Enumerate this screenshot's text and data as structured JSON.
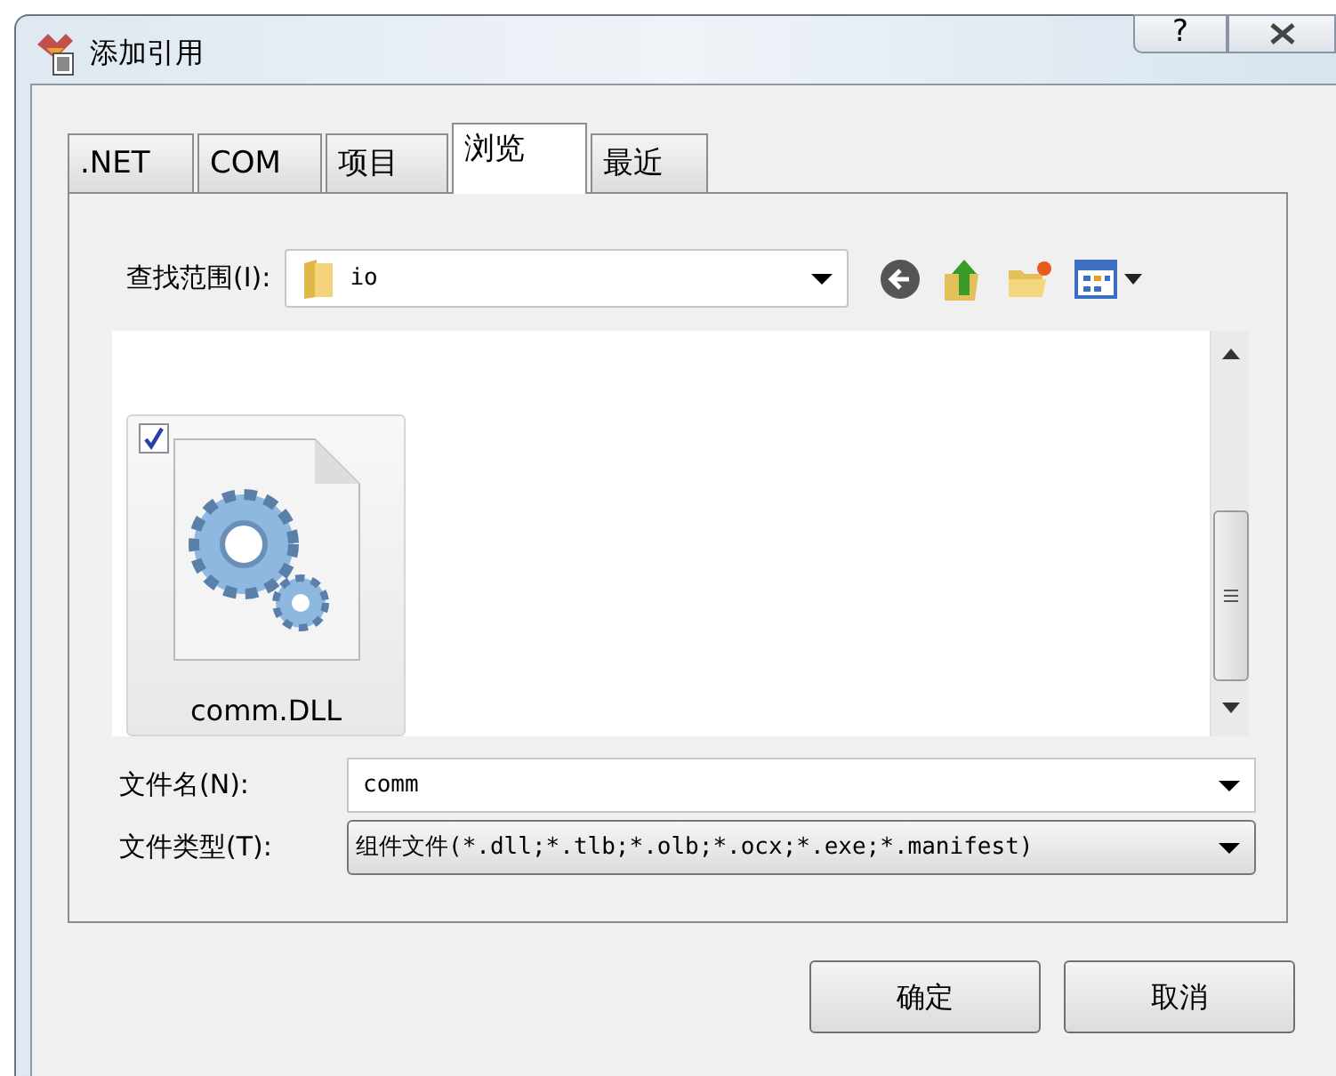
{
  "window": {
    "title": "添加引用",
    "help": "?"
  },
  "tabs": [
    {
      "label": ".NET",
      "selected": false
    },
    {
      "label": "COM",
      "selected": false
    },
    {
      "label": "项目",
      "selected": false
    },
    {
      "label": "浏览",
      "selected": true
    },
    {
      "label": "最近",
      "selected": false
    }
  ],
  "look_in": {
    "label": "查找范围(I):",
    "value": "io"
  },
  "files": [
    {
      "name": "comm.DLL",
      "checked": true,
      "selected": true
    }
  ],
  "file_name": {
    "label": "文件名(N):",
    "value": "comm"
  },
  "file_type": {
    "label": "文件类型(T):",
    "value": "组件文件(*.dll;*.tlb;*.olb;*.ocx;*.exe;*.manifest)"
  },
  "buttons": [
    {
      "label": "确定"
    },
    {
      "label": "取消"
    }
  ]
}
